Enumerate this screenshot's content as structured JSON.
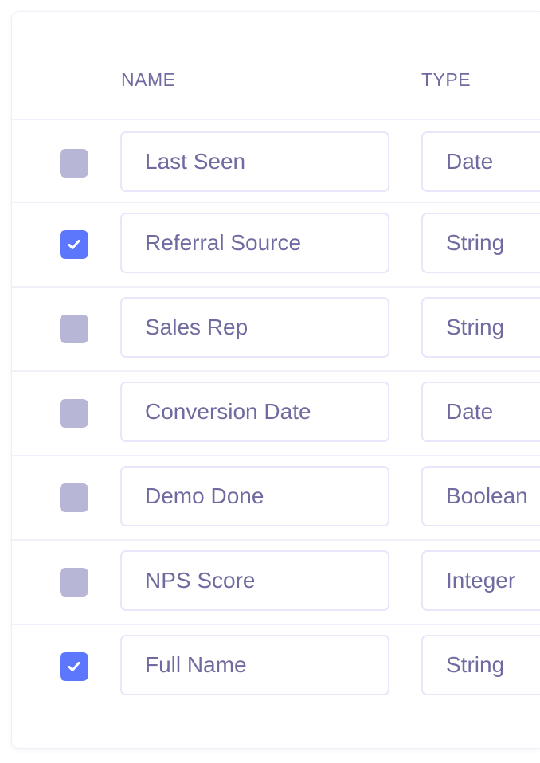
{
  "header": {
    "name": "NAME",
    "type": "TYPE"
  },
  "rows": [
    {
      "name": "Last Seen",
      "type": "Date",
      "checked": false
    },
    {
      "name": "Referral Source",
      "type": "String",
      "checked": true
    },
    {
      "name": "Sales Rep",
      "type": "String",
      "checked": false
    },
    {
      "name": "Conversion Date",
      "type": "Date",
      "checked": false
    },
    {
      "name": "Demo Done",
      "type": "Boolean",
      "checked": false
    },
    {
      "name": "NPS Score",
      "type": "Integer",
      "checked": false
    },
    {
      "name": "Full Name",
      "type": "String",
      "checked": true
    }
  ],
  "colors": {
    "checked": "#5c76fc",
    "unchecked": "#b7b6d6",
    "text": "#6f6ba0"
  }
}
